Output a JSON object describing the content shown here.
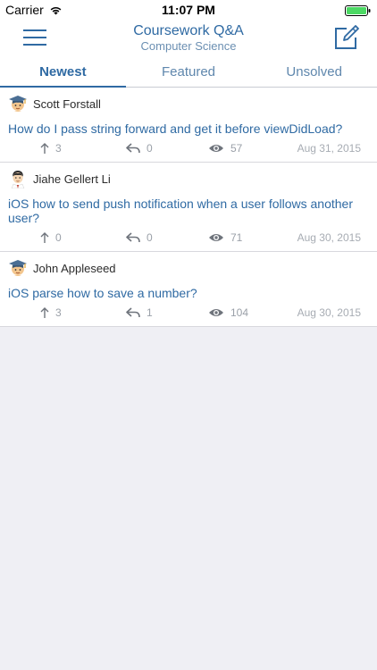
{
  "status_bar": {
    "carrier": "Carrier",
    "time": "11:07 PM"
  },
  "nav": {
    "title": "Coursework Q&A",
    "subtitle": "Computer Science",
    "menu_icon": "hamburger-menu-icon",
    "compose_icon": "compose-icon"
  },
  "tabs": [
    {
      "label": "Newest",
      "active": true
    },
    {
      "label": "Featured",
      "active": false
    },
    {
      "label": "Unsolved",
      "active": false
    }
  ],
  "questions": [
    {
      "author": "Scott Forstall",
      "avatar": "graduate-avatar-icon",
      "title": "How do I pass string forward and get it before viewDidLoad?",
      "upvotes": "3",
      "replies": "0",
      "views": "57",
      "date": "Aug 31, 2015"
    },
    {
      "author": "Jiahe Gellert Li",
      "avatar": "professor-avatar-icon",
      "title": "iOS how to send push notification when a user follows another user?",
      "upvotes": "0",
      "replies": "0",
      "views": "71",
      "date": "Aug 30, 2015"
    },
    {
      "author": "John Appleseed",
      "avatar": "graduate-avatar-icon",
      "title": "iOS parse how to save a number?",
      "upvotes": "3",
      "replies": "1",
      "views": "104",
      "date": "Aug 30, 2015"
    }
  ],
  "colors": {
    "accent": "#2f6aa3",
    "muted": "#9aa0a8",
    "background": "#efeff4",
    "battery": "#4cd964"
  }
}
